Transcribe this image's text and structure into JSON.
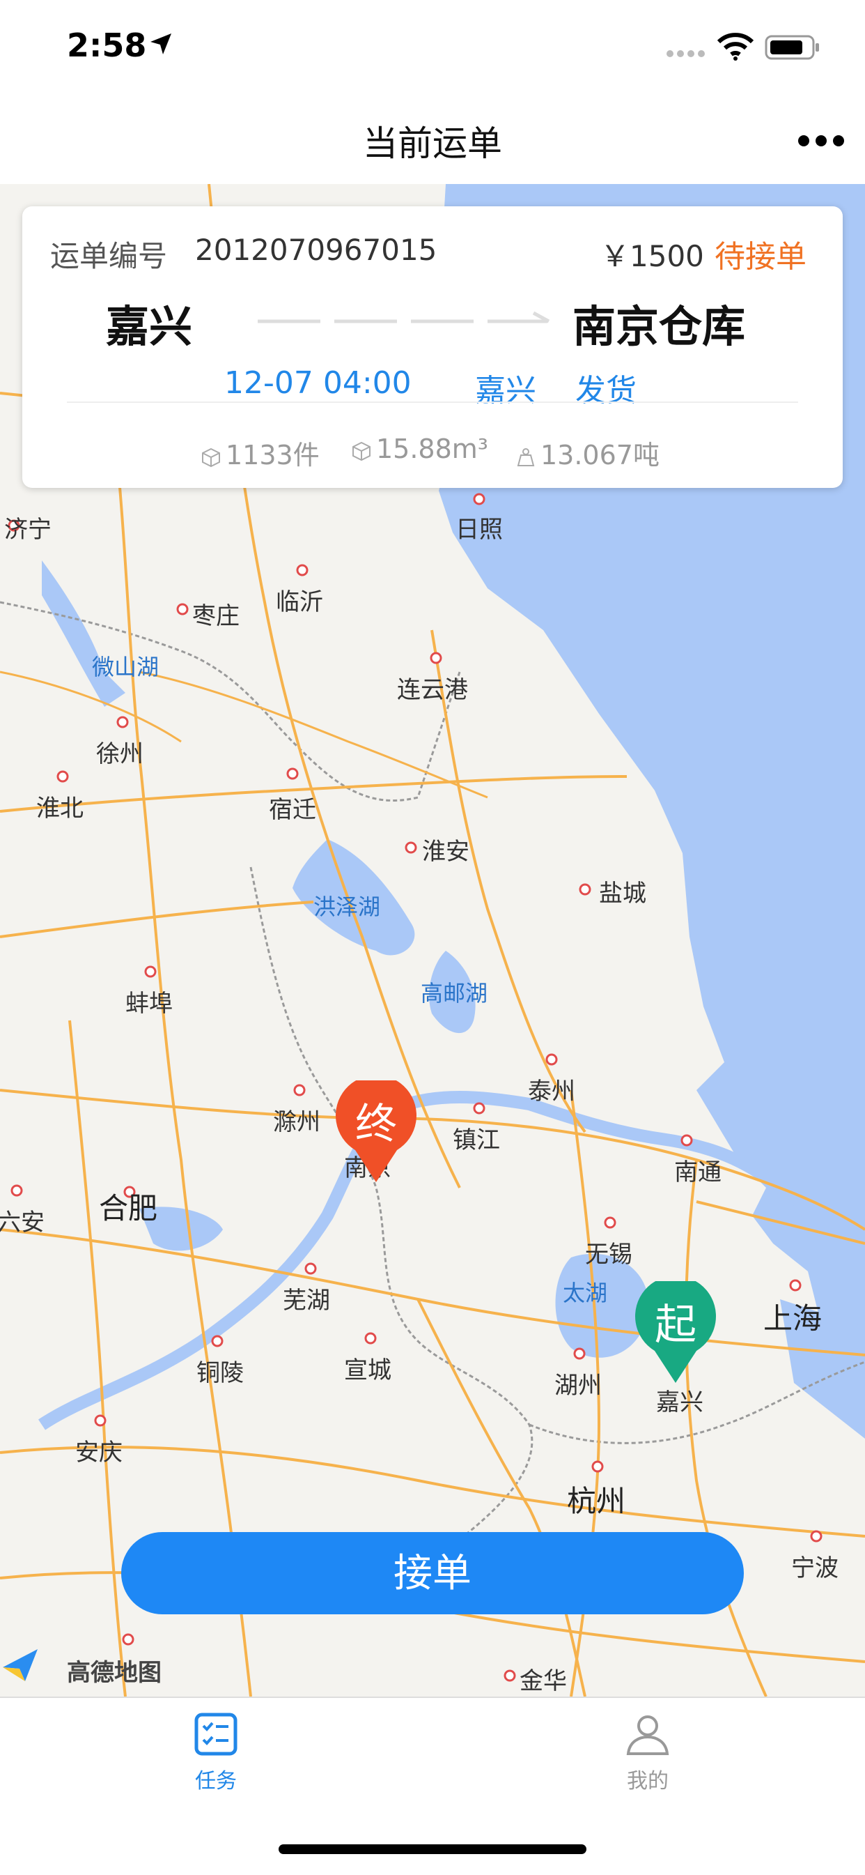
{
  "status_bar": {
    "time": "2:58"
  },
  "nav": {
    "title": "当前运单"
  },
  "order": {
    "label": "运单编号",
    "number": "2012070967015",
    "price": "￥1500",
    "status": "待接单",
    "from": "嘉兴",
    "to": "南京仓库",
    "time": "12-07 04:00",
    "city": "嘉兴",
    "action": "发货",
    "pieces": "1133件",
    "volume": "15.88m³",
    "weight": "13.067吨"
  },
  "map": {
    "cities": [
      "济宁",
      "日照",
      "枣庄",
      "临沂",
      "连云港",
      "徐州",
      "淮北",
      "宿迁",
      "淮安",
      "盐城",
      "蚌埠",
      "泰州",
      "滁州",
      "镇江",
      "南通",
      "六安",
      "无锡",
      "芜湖",
      "湖州",
      "嘉兴",
      "铜陵",
      "宣城",
      "安庆",
      "宁波",
      "金华",
      "南京"
    ],
    "big_cities": [
      "合肥",
      "上海",
      "杭州"
    ],
    "lakes": [
      "微山湖",
      "洪泽湖",
      "高邮湖",
      "太湖"
    ],
    "end_marker": "终",
    "start_marker": "起",
    "provider": "高德地图"
  },
  "accept_button": "接单",
  "tabs": [
    {
      "label": "任务",
      "active": true,
      "icon": "task-list-icon"
    },
    {
      "label": "我的",
      "active": false,
      "icon": "user-icon"
    }
  ],
  "colors": {
    "accent": "#1e88f5",
    "status": "#f07223",
    "start": "#18a982",
    "end": "#f05027",
    "water": "#aac8f7"
  }
}
